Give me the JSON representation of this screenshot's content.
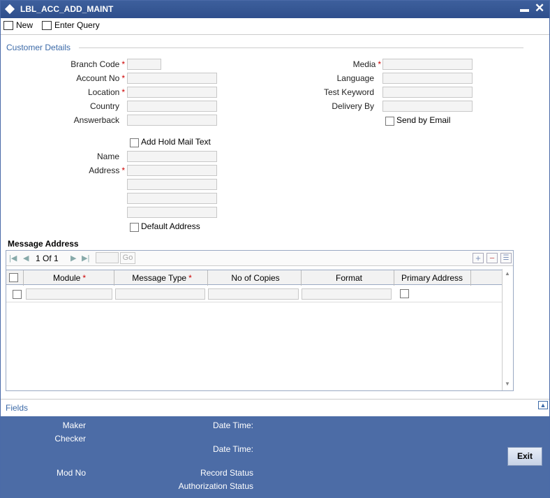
{
  "window": {
    "title": "LBL_ACC_ADD_MAINT",
    "minimize": "▬",
    "close": "✕"
  },
  "toolbar": {
    "new_label": "New",
    "enter_query_label": "Enter Query"
  },
  "customer": {
    "section_title": "Customer Details",
    "branch_code_label": "Branch Code",
    "account_no_label": "Account No",
    "location_label": "Location",
    "country_label": "Country",
    "answerback_label": "Answerback",
    "media_label": "Media",
    "language_label": "Language",
    "test_keyword_label": "Test Keyword",
    "delivery_by_label": "Delivery By",
    "send_by_email_label": "Send by Email",
    "add_hold_mail_label": "Add Hold Mail Text",
    "name_label": "Name",
    "address_label": "Address",
    "default_address_label": "Default Address",
    "required_marker": "*"
  },
  "message_address": {
    "section_title": "Message Address",
    "pager": {
      "current": "1",
      "of_label": "Of",
      "total": "1",
      "go_label": "Go"
    },
    "columns": [
      "Module",
      "Message Type",
      "No of Copies",
      "Format",
      "Primary Address"
    ]
  },
  "fields_label": "Fields",
  "footer": {
    "maker_label": "Maker",
    "checker_label": "Checker",
    "mod_no_label": "Mod No",
    "date_time_label": "Date Time:",
    "record_status_label": "Record Status",
    "auth_status_label": "Authorization Status",
    "exit_label": "Exit"
  }
}
